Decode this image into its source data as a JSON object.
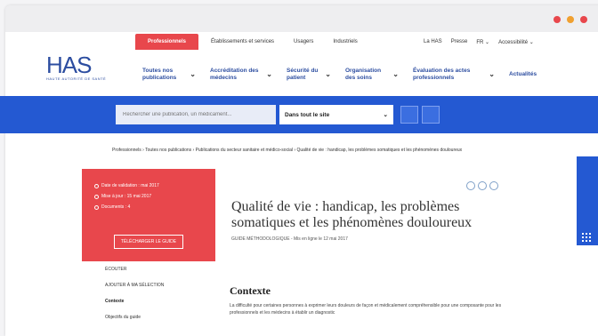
{
  "window": {
    "dots": [
      "#e8474c",
      "#f0a030",
      "#e8474c"
    ]
  },
  "topnav": {
    "professionals": "Professionnels",
    "items": [
      "Établissements et services",
      "Usagers",
      "Industriels"
    ]
  },
  "rightnav": {
    "items": [
      "La HAS",
      "Presse",
      "FR ⌄",
      "Accessibilité ⌄"
    ]
  },
  "logo": {
    "text": "HAS",
    "subtitle": "HAUTE AUTORITÉ DE SANTÉ"
  },
  "mainnav": {
    "items": [
      "Toutes nos publications",
      "Accréditation des médecins",
      "Sécurité du patient",
      "Organisation des soins",
      "Évaluation des actes professionnels",
      "Actualités"
    ]
  },
  "search": {
    "placeholder": "Rechercher une publication, un médicament...",
    "select_value": "Dans tout le site"
  },
  "breadcrumb": "Professionnels › Toutes nos publications › Publications du secteur sanitaire et médico-social › Qualité de vie : handicap, les problèmes somatiques et les phénomènes douloureux",
  "sidebar": {
    "items": [
      "Date de validation : mai 2017",
      "Mise à jour : 15 mai 2017",
      "Documents : 4"
    ],
    "button": "TÉLÉCHARGER LE GUIDE",
    "links": {
      "listen": "ÉCOUTER",
      "add": "AJOUTER À MA SÉLECTION",
      "contexte": "Contexte",
      "objectifs": "Objectifs du guide"
    }
  },
  "page": {
    "title": "Qualité de vie : handicap, les problèmes somatiques et les phénomènes douloureux",
    "meta": "GUIDE MÉTHODOLOGIQUE - Mis en ligne le 12 mai 2017",
    "section_title": "Contexte",
    "paragraph": "La difficulté pour certaines personnes à exprimer leurs douleurs de façon et médicalement compréhensible pour une composante pour les professionnels et les médecins à établir un diagnostic"
  }
}
